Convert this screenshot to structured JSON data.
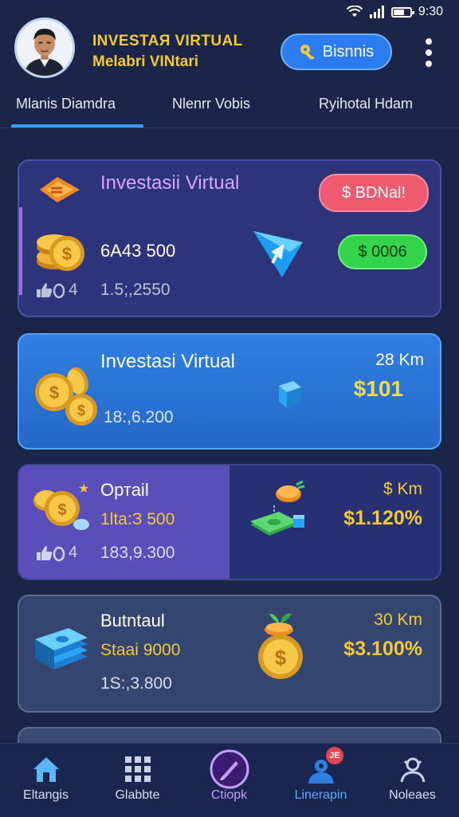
{
  "status_bar": {
    "time": "9:30"
  },
  "header": {
    "title_line1": "INVESTAЯ VIRTUAL",
    "title_line2": "Melabri VINtari",
    "business_button": "Bisnnis"
  },
  "tabs": [
    {
      "label": "Mlanis Diamdra",
      "active": true
    },
    {
      "label": "Nlenrr Vobis",
      "active": false
    },
    {
      "label": "Ryihotal Hdam",
      "active": false
    }
  ],
  "cards": [
    {
      "title": "Investasii Virtual",
      "amount": "6A43 500",
      "likes": "4",
      "sub_value": "1.5;,2550",
      "red_pill": "$ BDNal!",
      "green_pill": "$ 0006"
    },
    {
      "title": "Investasi Virtual",
      "distance": "28 Km",
      "price": "$101",
      "sub_value": "18:,6.200"
    },
    {
      "title": "Ортаіl",
      "amount": "1ltа:З 500",
      "likes": "4",
      "sub_value": "183,9.300",
      "distance": "$ Km",
      "percent": "$1.120%"
    },
    {
      "title": "Butntaul",
      "amount": "Staai 9000",
      "sub_value": "1S:,3.800",
      "distance": "30 Km",
      "percent": "$3.100%"
    }
  ],
  "bottom_nav": [
    {
      "label": "Eltangis",
      "icon": "home-icon"
    },
    {
      "label": "Glabbte",
      "icon": "grid-icon"
    },
    {
      "label": "Ctiopk",
      "icon": "pen-icon",
      "active": true
    },
    {
      "label": "Linerapin",
      "icon": "user-icon",
      "badge": "JE"
    },
    {
      "label": "Noleaes",
      "icon": "profile-icon"
    }
  ],
  "colors": {
    "background": "#1a2547",
    "accent": "#3a9cf7",
    "gold": "#f3c935",
    "red_pill": "#f05a6e",
    "green_pill": "#33d44a"
  }
}
